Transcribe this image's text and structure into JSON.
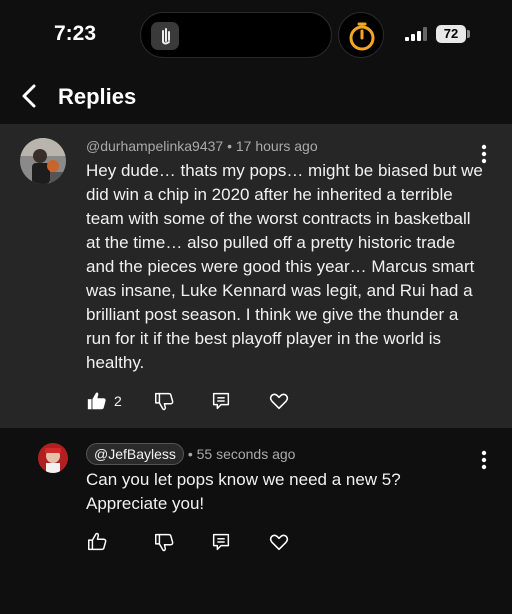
{
  "status": {
    "time": "7:23",
    "battery": "72"
  },
  "header": {
    "title": "Replies"
  },
  "parent_comment": {
    "author": "@durhampelinka9437",
    "separator": "•",
    "age": "17 hours ago",
    "text": "Hey dude… thats my pops… might be biased but we did win a chip in 2020 after he inherited a terrible team with some of the worst contracts in basketball at the time… also pulled off a pretty historic trade and the pieces were good this year… Marcus smart was insane, Luke Kennard was legit, and Rui had a brilliant post season. I think we give the thunder a run for it if the best playoff player in the world is healthy.",
    "likes": "2"
  },
  "reply_comment": {
    "author": "@JefBayless",
    "separator": "•",
    "age": "55 seconds ago",
    "text": "Can you let pops know we need a new 5? Appreciate you!"
  },
  "colors": {
    "parent_bg": "#262626",
    "page_bg": "#0f0f0f",
    "timer_accent": "#f5a623"
  }
}
